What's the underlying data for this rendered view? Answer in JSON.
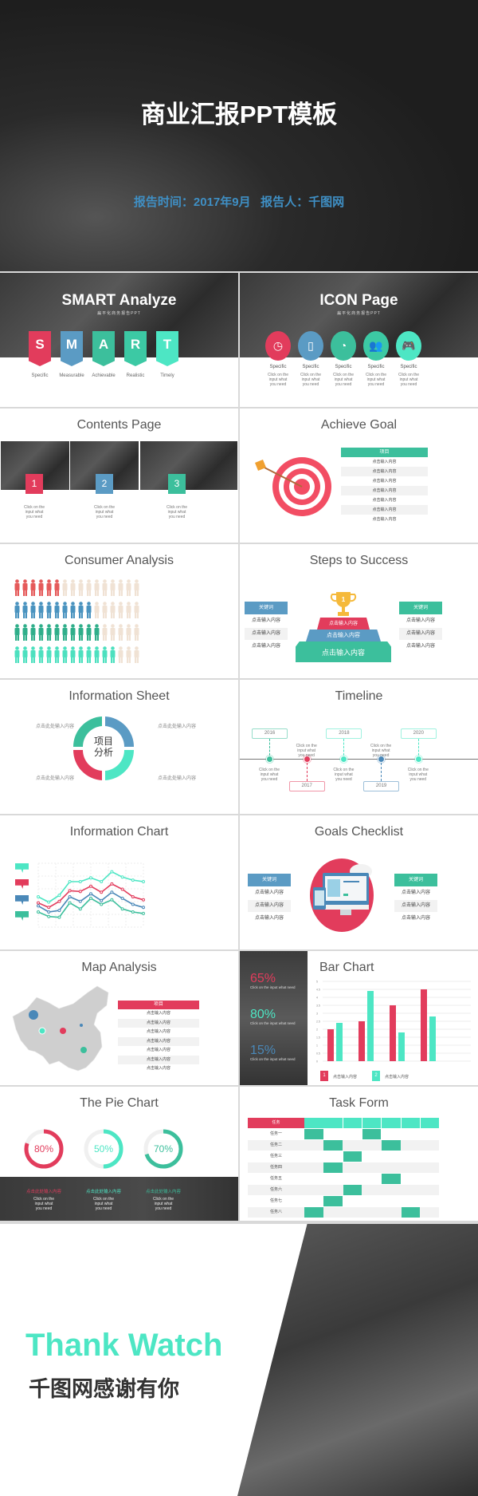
{
  "colors": {
    "red": "#e23c5c",
    "blue": "#5b9bc4",
    "green": "#3cbf9c",
    "teal": "#4de6c4",
    "beige": "#f0e2d4"
  },
  "hero": {
    "title": "商业汇报PPT模板",
    "subtitle": "报告时间：2017年9月   报告人：千图网"
  },
  "smart": {
    "title": "SMART Analyze",
    "subtitle": "扁平化商务报告PPT",
    "letters": [
      {
        "letter": "S",
        "label": "Specific",
        "color": "#e23c5c"
      },
      {
        "letter": "M",
        "label": "Measurable",
        "color": "#5b9bc4"
      },
      {
        "letter": "A",
        "label": "Achievable",
        "color": "#3cbf9c"
      },
      {
        "letter": "R",
        "label": "Realistic",
        "color": "#3cc9a4"
      },
      {
        "letter": "T",
        "label": "Timely",
        "color": "#4de6c4"
      }
    ]
  },
  "icon_page": {
    "title": "ICON Page",
    "subtitle": "扁平化商务报告PPT",
    "items": [
      {
        "icon": "clock-icon",
        "label": "Specific",
        "text": "Click on the input what you need",
        "color": "#e23c5c"
      },
      {
        "icon": "phone-icon",
        "label": "Specific",
        "text": "Click on the input what you need",
        "color": "#5b9bc4"
      },
      {
        "icon": "pie-chart-icon",
        "label": "Specific",
        "text": "Click on the input what you need",
        "color": "#3cbf9c"
      },
      {
        "icon": "users-icon",
        "label": "Specific",
        "text": "Click on the input what you need",
        "color": "#3cc9a4"
      },
      {
        "icon": "gamepad-icon",
        "label": "Specific",
        "text": "Click on the input what you need",
        "color": "#4de6c4"
      }
    ]
  },
  "contents": {
    "title": "Contents Page",
    "items": [
      {
        "num": "1",
        "text": "Click on the input what you need",
        "color": "#e23c5c"
      },
      {
        "num": "2",
        "text": "Click on the input what you need",
        "color": "#5b9bc4"
      },
      {
        "num": "3",
        "text": "Click on the input what you need",
        "color": "#3cbf9c"
      }
    ]
  },
  "achieve": {
    "title": "Achieve Goal",
    "header": "项目",
    "rows": [
      "点击输入内容",
      "点击输入内容",
      "点击输入内容",
      "点击输入内容",
      "点击输入内容",
      "点击输入内容",
      "点击输入内容"
    ]
  },
  "consumer": {
    "title": "Consumer Analysis",
    "total": 16,
    "rows": [
      {
        "filled": 6,
        "color": "#e55a5a"
      },
      {
        "filled": 10,
        "color": "#4a93bf"
      },
      {
        "filled": 11,
        "color": "#2fae8a"
      },
      {
        "filled": 13,
        "color": "#4de0bf"
      }
    ]
  },
  "steps": {
    "title": "Steps to Success",
    "trophy": "1",
    "left": {
      "keyword": "关键词",
      "rows": [
        "点击输入内容",
        "点击输入内容",
        "点击输入内容"
      ]
    },
    "right": {
      "keyword": "关键词",
      "rows": [
        "点击输入内容",
        "点击输入内容",
        "点击输入内容"
      ]
    },
    "podium": [
      "点击输入内容",
      "点击输入内容",
      "点击输入内容"
    ]
  },
  "info_sheet": {
    "title": "Information Sheet",
    "center": [
      "项目",
      "分析"
    ],
    "labels": [
      "点击此处输入内容",
      "点击此处输入内容",
      "点击此处输入内容",
      "点击此处输入内容"
    ]
  },
  "timeline": {
    "title": "Timeline",
    "points": [
      {
        "year": "2016",
        "text": "Click on the input what you need",
        "color": "#3cbf9c",
        "above": true
      },
      {
        "year": "2017",
        "text": "Click on the input what you need",
        "color": "#e23c5c",
        "above": false
      },
      {
        "year": "2018",
        "text": "Click on the input what you need",
        "color": "#4de6c4",
        "above": true
      },
      {
        "year": "2019",
        "text": "Click on the input what you need",
        "color": "#4a88b8",
        "above": false
      },
      {
        "year": "2020",
        "text": "Click on the input what you need",
        "color": "#4de6c4",
        "above": true
      }
    ]
  },
  "info_chart": {
    "title": "Information Chart",
    "flag_colors": [
      "#4de6c4",
      "#e23c5c",
      "#4a88b8",
      "#3cbf9c"
    ]
  },
  "chart_data": [
    {
      "type": "line",
      "series": [
        {
          "color": "#4de6c4",
          "values": [
            60,
            53,
            62,
            80,
            80,
            85,
            80,
            93,
            86,
            82,
            80
          ]
        },
        {
          "color": "#e23c5c",
          "values": [
            52,
            46,
            54,
            68,
            67,
            74,
            66,
            77,
            70,
            60,
            56
          ]
        },
        {
          "color": "#4a88b8",
          "values": [
            48,
            40,
            42,
            60,
            54,
            64,
            55,
            66,
            58,
            50,
            46
          ]
        },
        {
          "color": "#3cbf9c",
          "values": [
            40,
            34,
            33,
            52,
            44,
            58,
            50,
            56,
            44,
            40,
            38
          ]
        }
      ]
    },
    {
      "type": "bar",
      "categories": [
        "1",
        "2",
        "3",
        "4"
      ],
      "ylim": [
        0,
        5
      ],
      "yticks": [
        "0",
        "0.5",
        "1",
        "1.5",
        "2",
        "2.5",
        "3",
        "3.5",
        "4",
        "4.5",
        "5"
      ],
      "series": [
        {
          "name": "点击输入内容",
          "color": "#e23c5c",
          "values": [
            2,
            2.5,
            3.5,
            4.5
          ]
        },
        {
          "name": "点击输入内容",
          "color": "#4de6c4",
          "values": [
            2.4,
            4.4,
            1.8,
            2.8
          ]
        }
      ]
    },
    {
      "type": "pie",
      "values": [
        80,
        50,
        70
      ],
      "labels": [
        "80%",
        "50%",
        "70%"
      ],
      "colors": [
        "#e23c5c",
        "#4de6c4",
        "#3cbf9c"
      ]
    }
  ],
  "goals": {
    "title": "Goals Checklist",
    "left": {
      "keyword": "关键词",
      "rows": [
        "点击输入内容",
        "点击输入内容",
        "点击输入内容"
      ]
    },
    "right": {
      "keyword": "关键词",
      "rows": [
        "点击输入内容",
        "点击输入内容",
        "点击输入内容"
      ]
    }
  },
  "map": {
    "title": "Map Analysis",
    "header": "项目",
    "rows": [
      "点击输入内容",
      "点击输入内容",
      "点击输入内容",
      "点击输入内容",
      "点击输入内容",
      "点击输入内容",
      "点击输入内容"
    ]
  },
  "bar_slide": {
    "title": "Bar Chart",
    "stats": [
      {
        "value": "65%",
        "text": "Click on the input what need",
        "color": "#e23c5c"
      },
      {
        "value": "80%",
        "text": "Click on the input what need",
        "color": "#4de6c4"
      },
      {
        "value": "15%",
        "text": "Click on the input what need",
        "color": "#4a88b8"
      }
    ],
    "legend": [
      {
        "num": "1",
        "label": "点击输入内容"
      },
      {
        "num": "2",
        "label": "点击输入内容"
      }
    ]
  },
  "pie_slide": {
    "title": "The Pie Chart",
    "items": [
      {
        "heading": "点击此处输入内容",
        "text": "Click on the input what you need"
      },
      {
        "heading": "点击此处输入内容",
        "text": "Click on the input what you need"
      },
      {
        "heading": "点击此处输入内容",
        "text": "Click on the input what you need"
      }
    ]
  },
  "task": {
    "title": "Task Form",
    "header": "任务",
    "rows": [
      {
        "name": "任务一",
        "cells": [
          0,
          3
        ]
      },
      {
        "name": "任务二",
        "cells": [
          1,
          4
        ]
      },
      {
        "name": "任务三",
        "cells": [
          2
        ]
      },
      {
        "name": "任务四",
        "cells": [
          1
        ]
      },
      {
        "name": "任务五",
        "cells": [
          4
        ]
      },
      {
        "name": "任务六",
        "cells": [
          2
        ]
      },
      {
        "name": "任务七",
        "cells": [
          1
        ]
      },
      {
        "name": "任务八",
        "cells": [
          0,
          5
        ]
      }
    ]
  },
  "ending": {
    "title": "Thank Watch",
    "subtitle": "千图网感谢有你"
  }
}
